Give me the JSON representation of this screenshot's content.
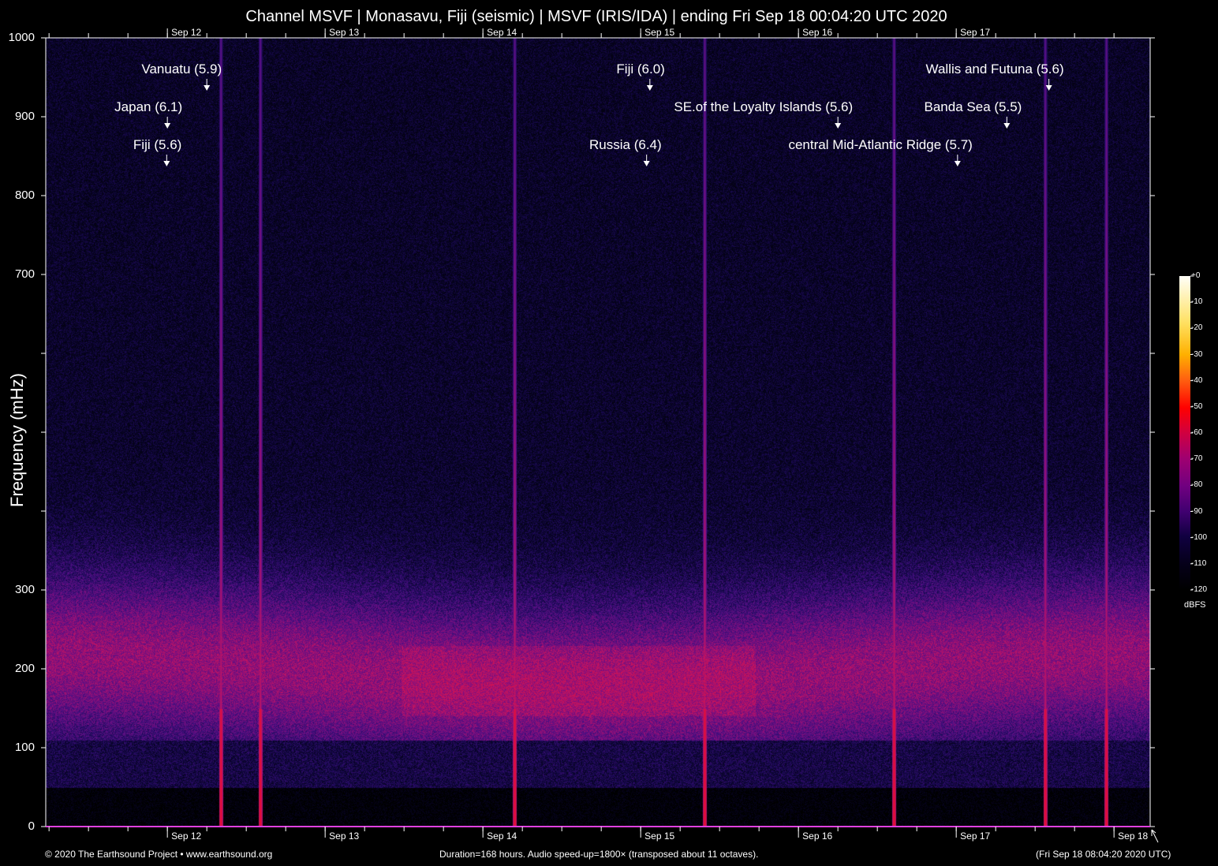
{
  "title": "Channel MSVF | Monasavu, Fiji (seismic) | MSVF (IRIS/IDA) | ending Fri Sep 18 00:04:20 UTC 2020",
  "chart_data": {
    "type": "heatmap",
    "title": "Channel MSVF | Monasavu, Fiji (seismic) | MSVF (IRIS/IDA) | ending Fri Sep 18 00:04:20 UTC 2020",
    "ylabel": "Frequency (mHz)",
    "ylim": [
      0,
      1000
    ],
    "y_ticks": [
      0,
      100,
      200,
      300,
      400,
      500,
      600,
      700,
      800,
      900,
      1000
    ],
    "y_tick_labels": [
      "0",
      "100",
      "200",
      "300",
      "",
      "",
      "",
      "700",
      "800",
      "900",
      "1000"
    ],
    "x_range_hours": [
      0,
      168
    ],
    "x_ticks_hours": [
      18.5,
      42.5,
      66.5,
      90.5,
      114.5,
      138.5
    ],
    "x_tick_labels_top": [
      "Sep 12",
      "Sep 13",
      "Sep 14",
      "Sep 15",
      "Sep 16",
      "Sep 17"
    ],
    "x_ticks_bottom_hours": [
      18.5,
      42.5,
      66.5,
      90.5,
      114.5,
      138.5,
      162.5
    ],
    "x_tick_labels_bottom": [
      "Sep 12",
      "Sep 13",
      "Sep 14",
      "Sep 15",
      "Sep 16",
      "Sep 17",
      "Sep 18"
    ],
    "colorbar": {
      "unit": "dBFS",
      "range": [
        -120,
        0
      ],
      "tick_labels": [
        "+0",
        "-10",
        "-20",
        "-30",
        "-40",
        "-50",
        "-60",
        "-70",
        "-80",
        "-90",
        "-100",
        "-110",
        "-120"
      ]
    },
    "background_band_mhz": [
      120,
      300
    ],
    "events": [
      {
        "label": "Vanuatu (5.9)",
        "hours": 24.5
      },
      {
        "label": "Japan (6.1)",
        "hours": 18.5
      },
      {
        "label": "Fiji (5.6)",
        "hours": 18.4
      },
      {
        "label": "Fiji (6.0)",
        "hours": 91.9
      },
      {
        "label": "SE.of the Loyalty Islands (5.6)",
        "hours": 120.5
      },
      {
        "label": "Russia (6.4)",
        "hours": 91.4
      },
      {
        "label": "central Mid-Atlantic Ridge (5.7)",
        "hours": 138.7
      },
      {
        "label": "Wallis and Futuna (5.6)",
        "hours": 152.6
      },
      {
        "label": "Banda Sea (5.5)",
        "hours": 146.2
      }
    ],
    "bright_streaks_hours": [
      26.6,
      32.6,
      71.3,
      100.2,
      129.0,
      152.0,
      161.3
    ]
  },
  "footer": {
    "copyright": "© 2020 The Earthsound Project • www.earthsound.org",
    "duration": "Duration=168 hours. Audio speed-up=1800× (transposed about 11 octaves).",
    "local_time": "(Fri Sep 18 08:04:20 2020 UTC)"
  }
}
